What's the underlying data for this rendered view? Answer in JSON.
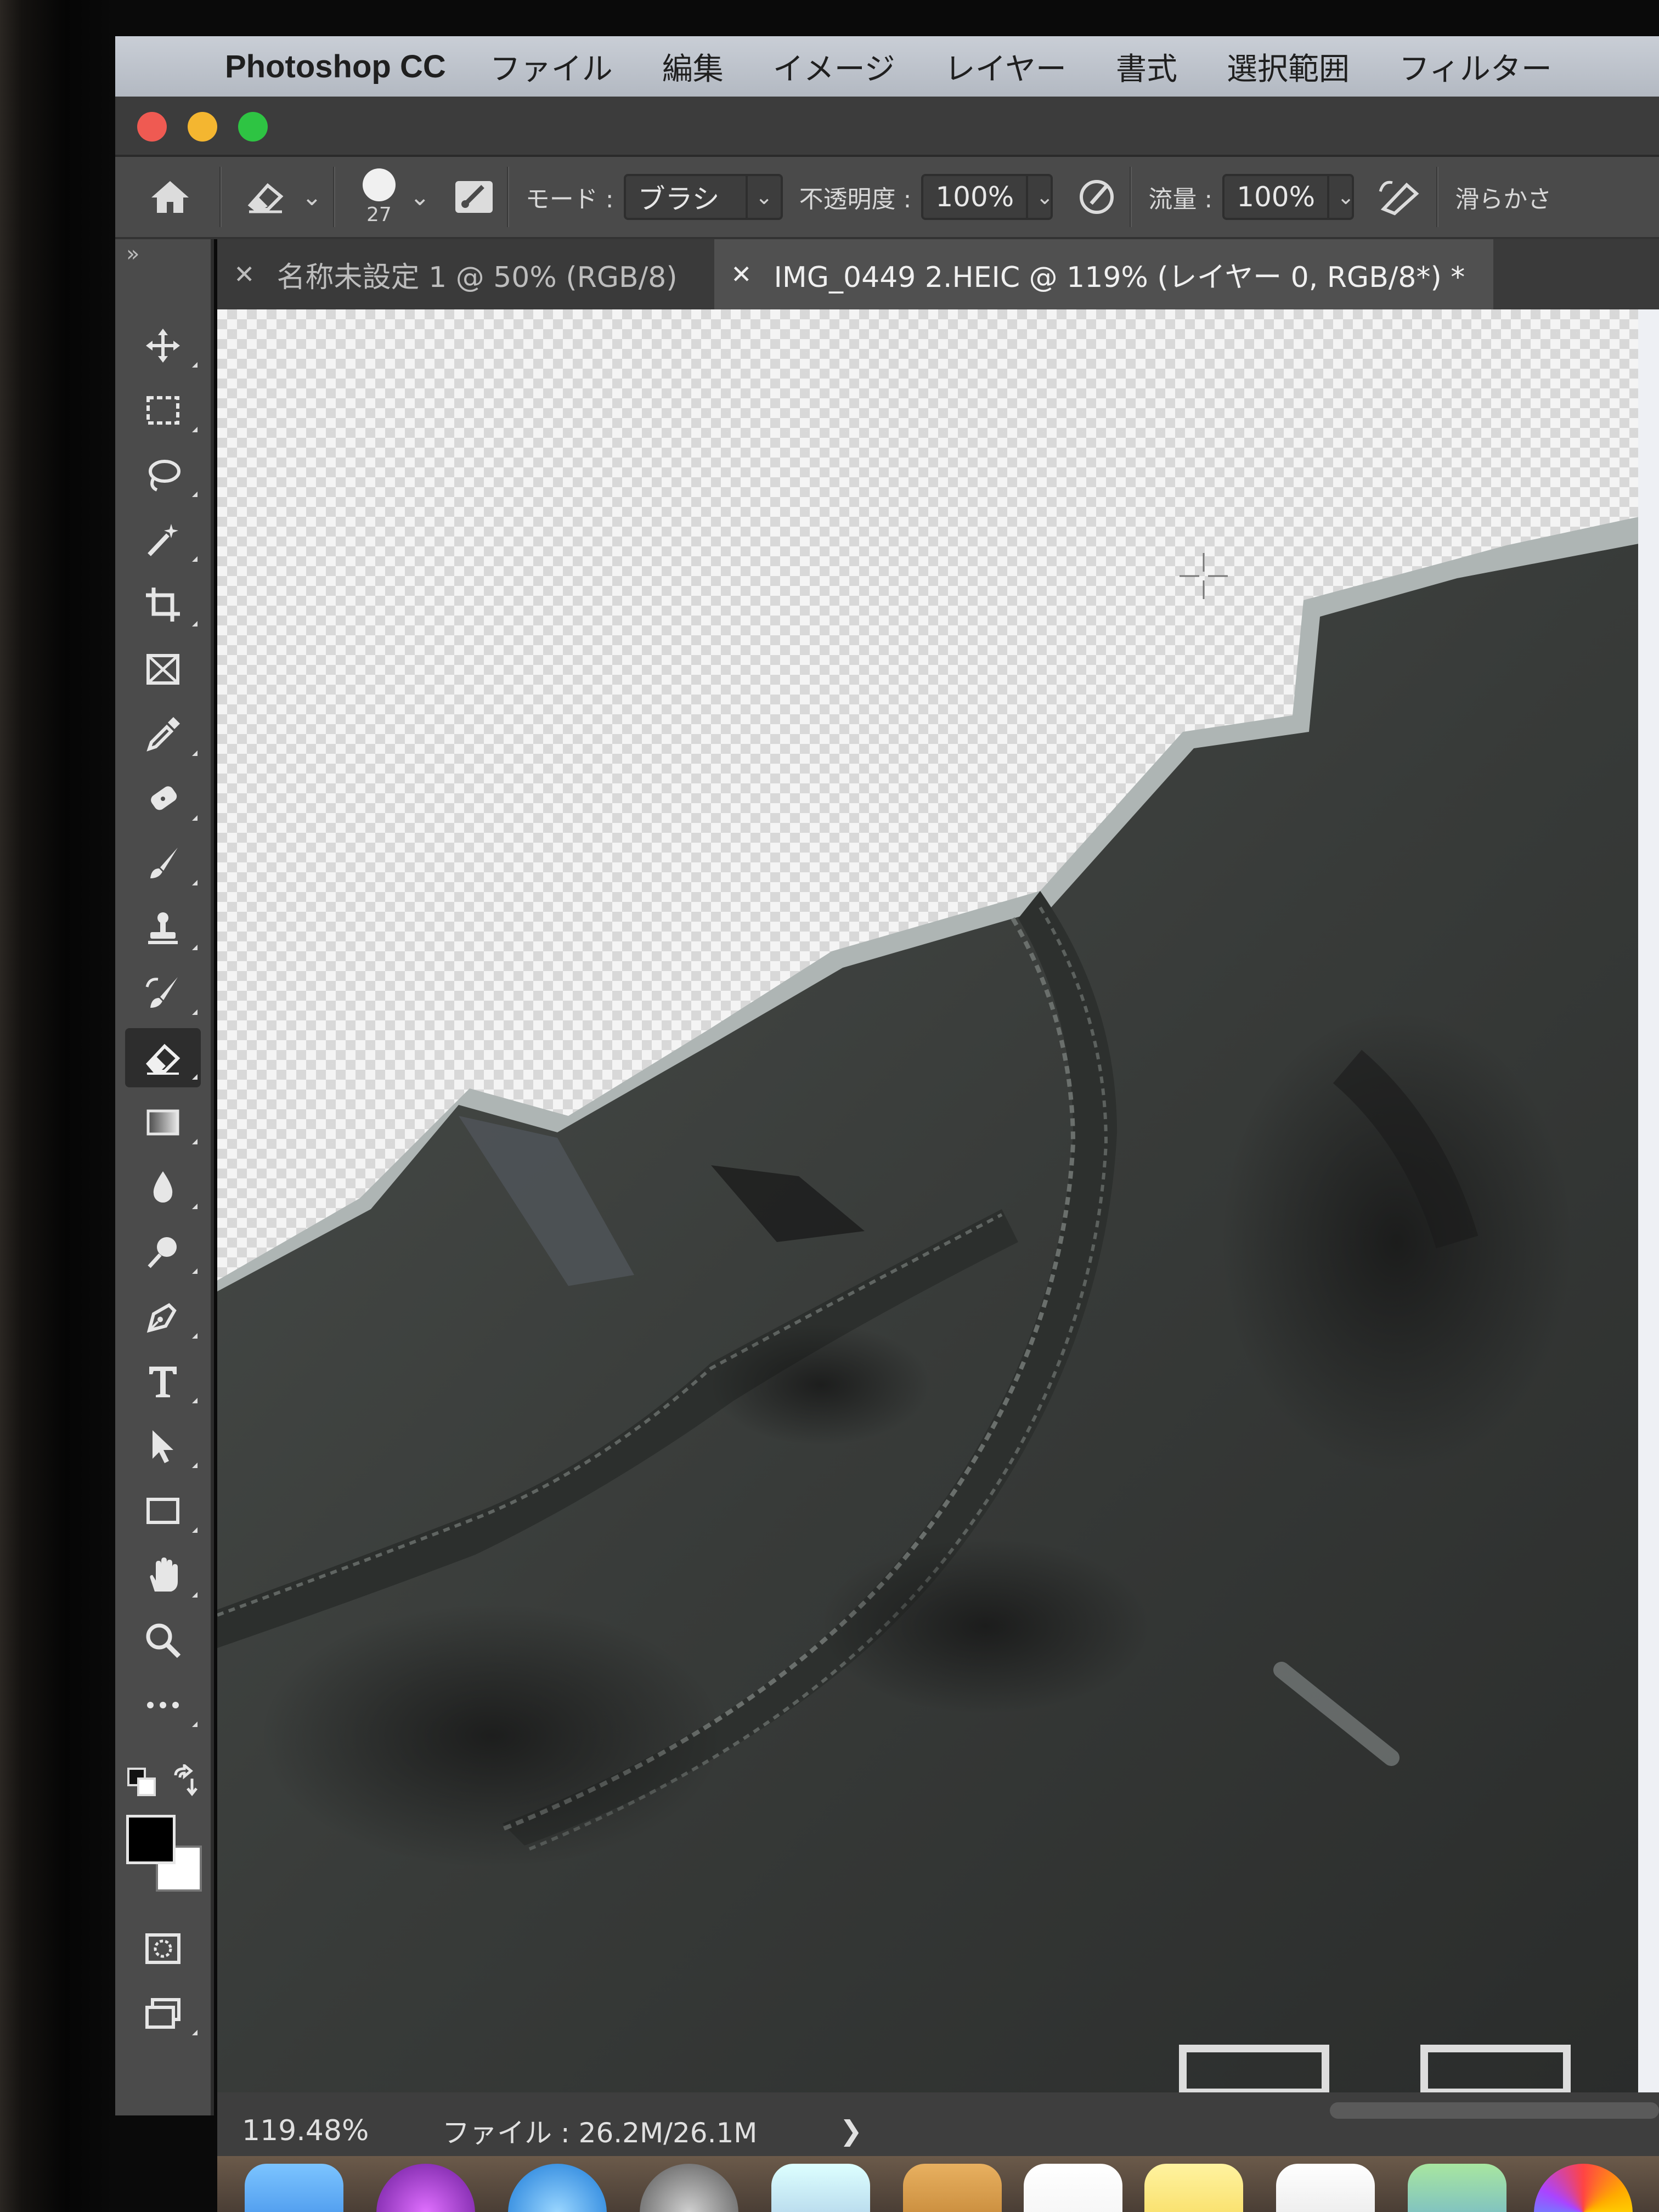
{
  "menubar": {
    "app_name": "Photoshop CC",
    "items": [
      "ファイル",
      "編集",
      "イメージ",
      "レイヤー",
      "書式",
      "選択範囲",
      "フィルター"
    ]
  },
  "options": {
    "brush_size": "27",
    "mode_label": "モード :",
    "mode_value": "ブラシ",
    "opacity_label": "不透明度 :",
    "opacity_value": "100%",
    "flow_label": "流量 :",
    "flow_value": "100%",
    "smoothing_label": "滑らかさ"
  },
  "tabs": [
    {
      "label": "名称未設定 1 @ 50% (RGB/8)",
      "active": false
    },
    {
      "label": "IMG_0449 2.HEIC @ 119% (レイヤー 0, RGB/8*) *",
      "active": true
    }
  ],
  "tools": [
    "move-tool",
    "marquee-tool",
    "lasso-tool",
    "magic-wand-tool",
    "crop-tool",
    "frame-tool",
    "eyedropper-tool",
    "healing-brush-tool",
    "brush-tool",
    "clone-stamp-tool",
    "history-brush-tool",
    "eraser-tool",
    "gradient-tool",
    "blur-tool",
    "dodge-tool",
    "pen-tool",
    "type-tool",
    "path-selection-tool",
    "rectangle-tool",
    "hand-tool",
    "zoom-tool",
    "more-tools"
  ],
  "status": {
    "zoom": "119.48%",
    "file_info": "ファイル : 26.2M/26.1M",
    "arrow": "❯"
  },
  "colors": {
    "foreground": "#000000",
    "background": "#ffffff",
    "canvas_shirt": "#3a3d3a"
  }
}
